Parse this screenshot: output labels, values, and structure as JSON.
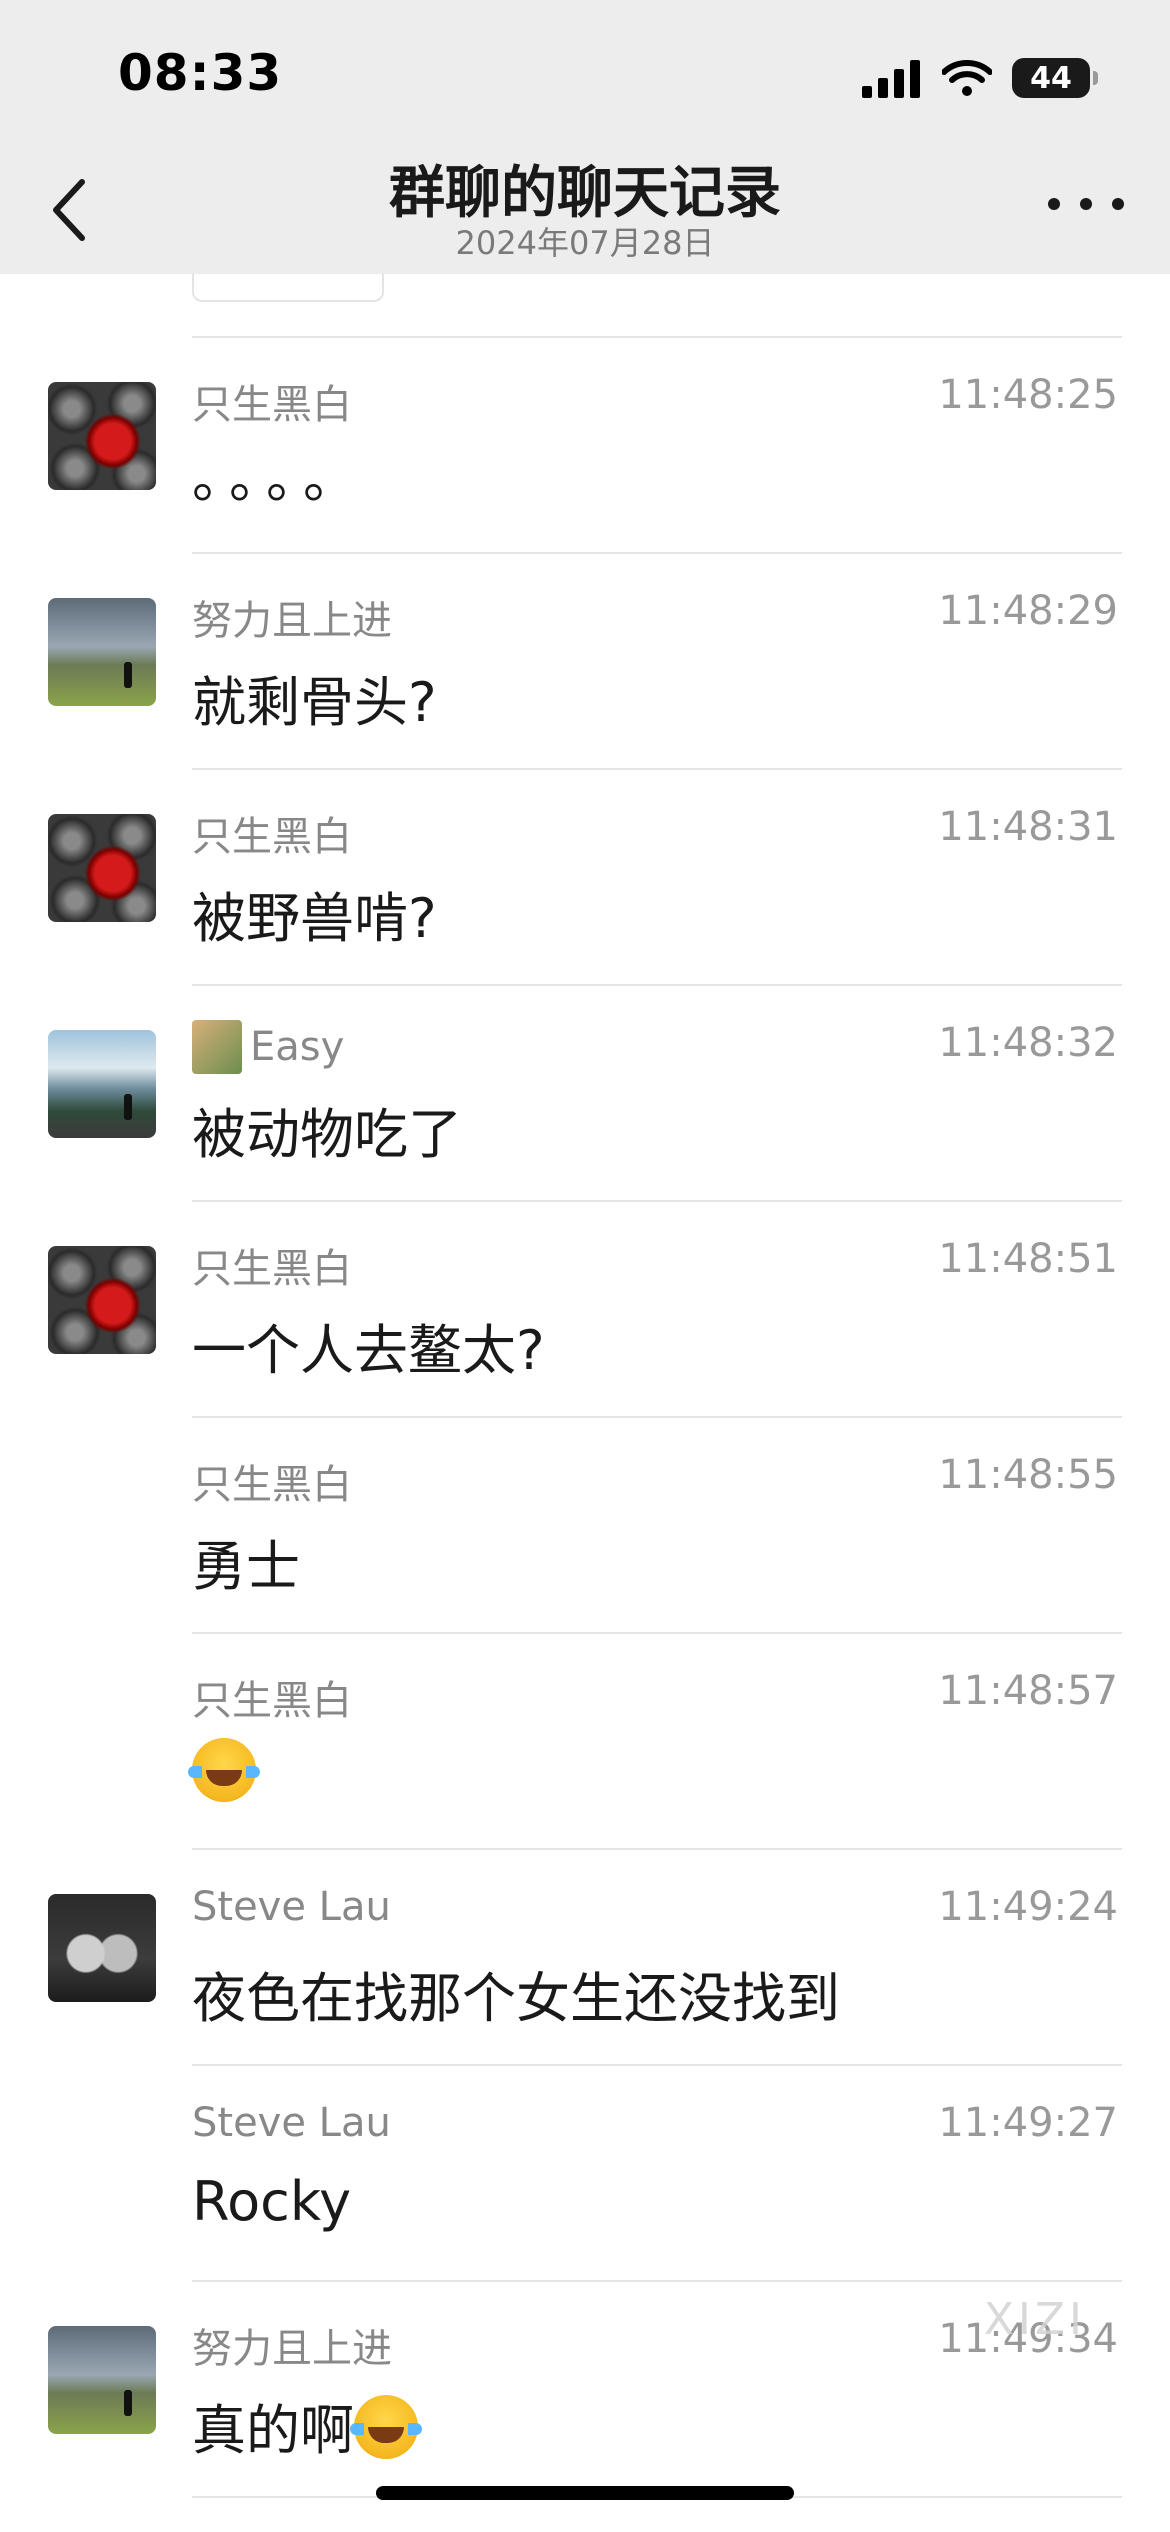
{
  "status_bar": {
    "time": "08:33",
    "battery": "44"
  },
  "nav": {
    "title": "群聊的聊天记录",
    "date": "2024年07月28日"
  },
  "messages": [
    {
      "sender": "只生黑白",
      "time": "11:48:25",
      "text": "。。。。",
      "avatar": "bw"
    },
    {
      "sender": "努力且上进",
      "time": "11:48:29",
      "text": "就剩骨头?",
      "avatar": "landscape"
    },
    {
      "sender": "只生黑白",
      "time": "11:48:31",
      "text": "被野兽啃?",
      "avatar": "bw"
    },
    {
      "sender": "Easy",
      "time": "11:48:32",
      "text": "被动物吃了",
      "avatar": "mountain"
    },
    {
      "sender": "只生黑白",
      "time": "11:48:51",
      "text": "一个人去鳌太?",
      "avatar": "bw"
    },
    {
      "sender": "只生黑白",
      "time": "11:48:55",
      "text": "勇士",
      "avatar": "none"
    },
    {
      "sender": "只生黑白",
      "time": "11:48:57",
      "text": "",
      "emoji": "tears-of-joy",
      "avatar": "none"
    },
    {
      "sender": "Steve Lau",
      "time": "11:49:24",
      "text": "夜色在找那个女生还没找到",
      "avatar": "robot"
    },
    {
      "sender": "Steve Lau",
      "time": "11:49:27",
      "text": "Rocky",
      "avatar": "none"
    },
    {
      "sender": "努力且上进",
      "time": "11:49:34",
      "text": "真的啊",
      "emoji": "crying-face",
      "avatar": "landscape"
    }
  ],
  "watermark": "XIZI",
  "icons": {
    "back": "chevron-left-icon",
    "more": "ellipsis-icon",
    "signal": "cellular-signal-icon",
    "wifi": "wifi-icon"
  }
}
